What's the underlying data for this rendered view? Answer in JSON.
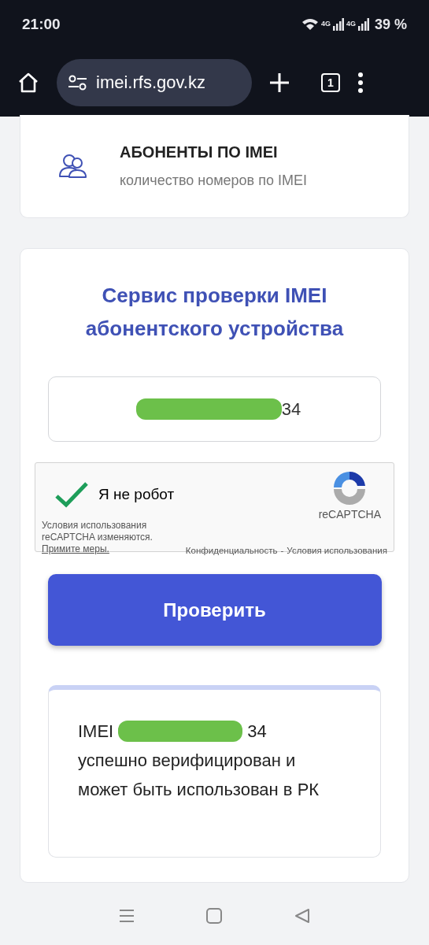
{
  "status_bar": {
    "time": "21:00",
    "network": [
      "4G",
      "4G"
    ],
    "battery": "39 %"
  },
  "browser": {
    "url": "imei.rfs.gov.kz",
    "tab_count": "1"
  },
  "subscribers_card": {
    "title": "АБОНЕНТЫ ПО IMEI",
    "subtitle": "количество номеров по IMEI"
  },
  "service": {
    "title": "Сервис проверки IMEI абонентского устройства",
    "imei_field": {
      "masked": true,
      "value": "34"
    },
    "recaptcha": {
      "checked": true,
      "label": "Я не робот",
      "brand": "reCAPTCHA",
      "notice": "Условия использования reCAPTCHA изменяются.",
      "notice_link": "Примите меры.",
      "privacy": "Конфиденциальность",
      "separator": "-",
      "terms": "Условия использования"
    },
    "button": "Проверить",
    "result": {
      "prefix": "IMEI",
      "masked": true,
      "suffix": "34",
      "message": "успешно верифицирован и может быть использован в РК"
    }
  }
}
